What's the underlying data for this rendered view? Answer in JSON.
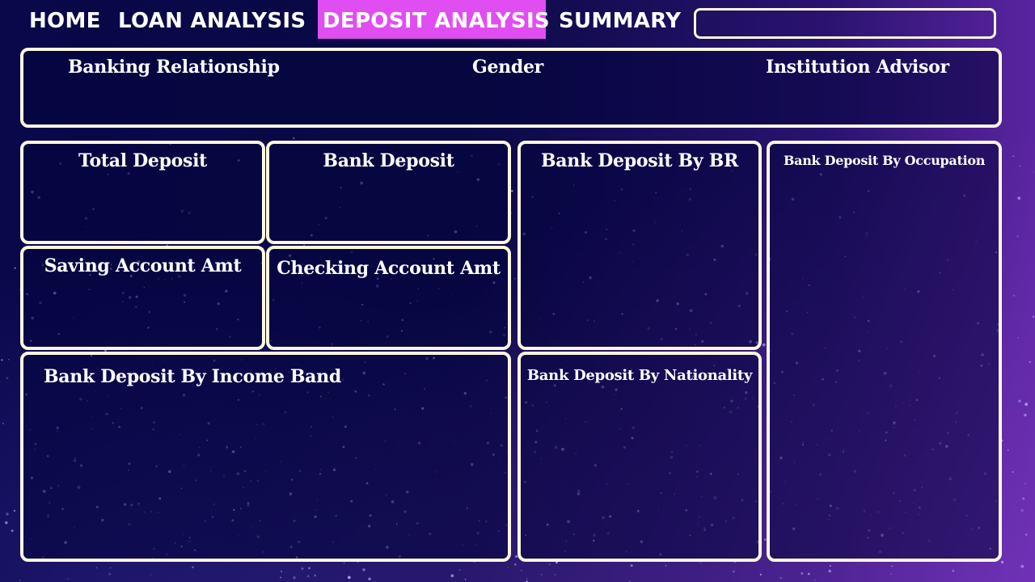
{
  "nav": {
    "home": "HOME",
    "loan_analysis": "LOAN ANALYSIS",
    "deposit_analysis": "DEPOSIT ANALYSIS",
    "summary": "SUMMARY",
    "active_color": "#e04ef2"
  },
  "search": {
    "value": "",
    "placeholder": ""
  },
  "filters": {
    "banking_relationship": "Banking Relationship",
    "gender": "Gender",
    "institution_advisor": "Institution Advisor"
  },
  "cards": {
    "total_deposit": "Total Deposit",
    "bank_deposit": "Bank Deposit",
    "saving_account_amt": "Saving Account Amt",
    "checking_account_amt": "Checking Account Amt"
  },
  "charts": {
    "by_br": "Bank Deposit By BR",
    "by_occupation": "Bank Deposit By Occupation",
    "by_income_band": "Bank Deposit By Income Band",
    "by_nationality": "Bank Deposit By Nationality"
  },
  "colors": {
    "panel_border": "#fdf7df",
    "background_dark": "#08084a",
    "background_accent": "#5a24a0"
  }
}
